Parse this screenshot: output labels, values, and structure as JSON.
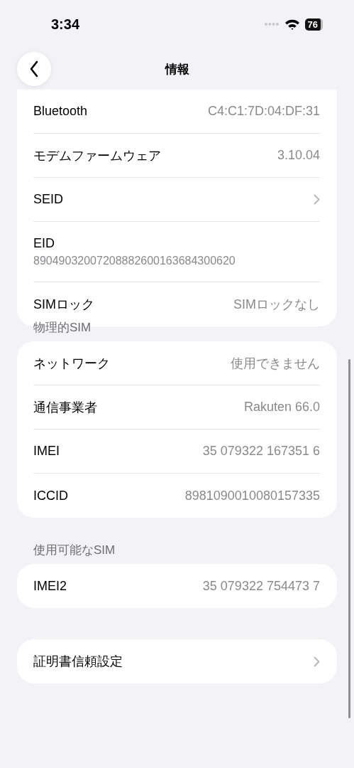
{
  "status_bar": {
    "time": "3:34",
    "battery": "76"
  },
  "nav": {
    "title": "情報"
  },
  "sections": [
    {
      "rows": [
        {
          "kind": "value",
          "label": "Bluetooth",
          "value": "C4:C1:7D:04:DF:31"
        },
        {
          "kind": "value",
          "label": "モデムファームウェア",
          "value": "3.10.04"
        },
        {
          "kind": "chevron",
          "label": "SEID"
        },
        {
          "kind": "stacked",
          "label": "EID",
          "value": "89049032007208882600163684300620"
        },
        {
          "kind": "value",
          "label": "SIMロック",
          "value": "SIMロックなし"
        }
      ]
    },
    {
      "header": "物理的SIM",
      "rows": [
        {
          "kind": "value",
          "label": "ネットワーク",
          "value": "使用できません"
        },
        {
          "kind": "value",
          "label": "通信事業者",
          "value": "Rakuten 66.0"
        },
        {
          "kind": "value",
          "label": "IMEI",
          "value": "35 079322 167351 6"
        },
        {
          "kind": "value",
          "label": "ICCID",
          "value": "8981090010080157335"
        }
      ]
    },
    {
      "header": "使用可能なSIM",
      "rows": [
        {
          "kind": "value",
          "label": "IMEI2",
          "value": "35 079322 754473 7"
        }
      ]
    },
    {
      "rows": [
        {
          "kind": "chevron",
          "label": "証明書信頼設定"
        }
      ]
    }
  ]
}
